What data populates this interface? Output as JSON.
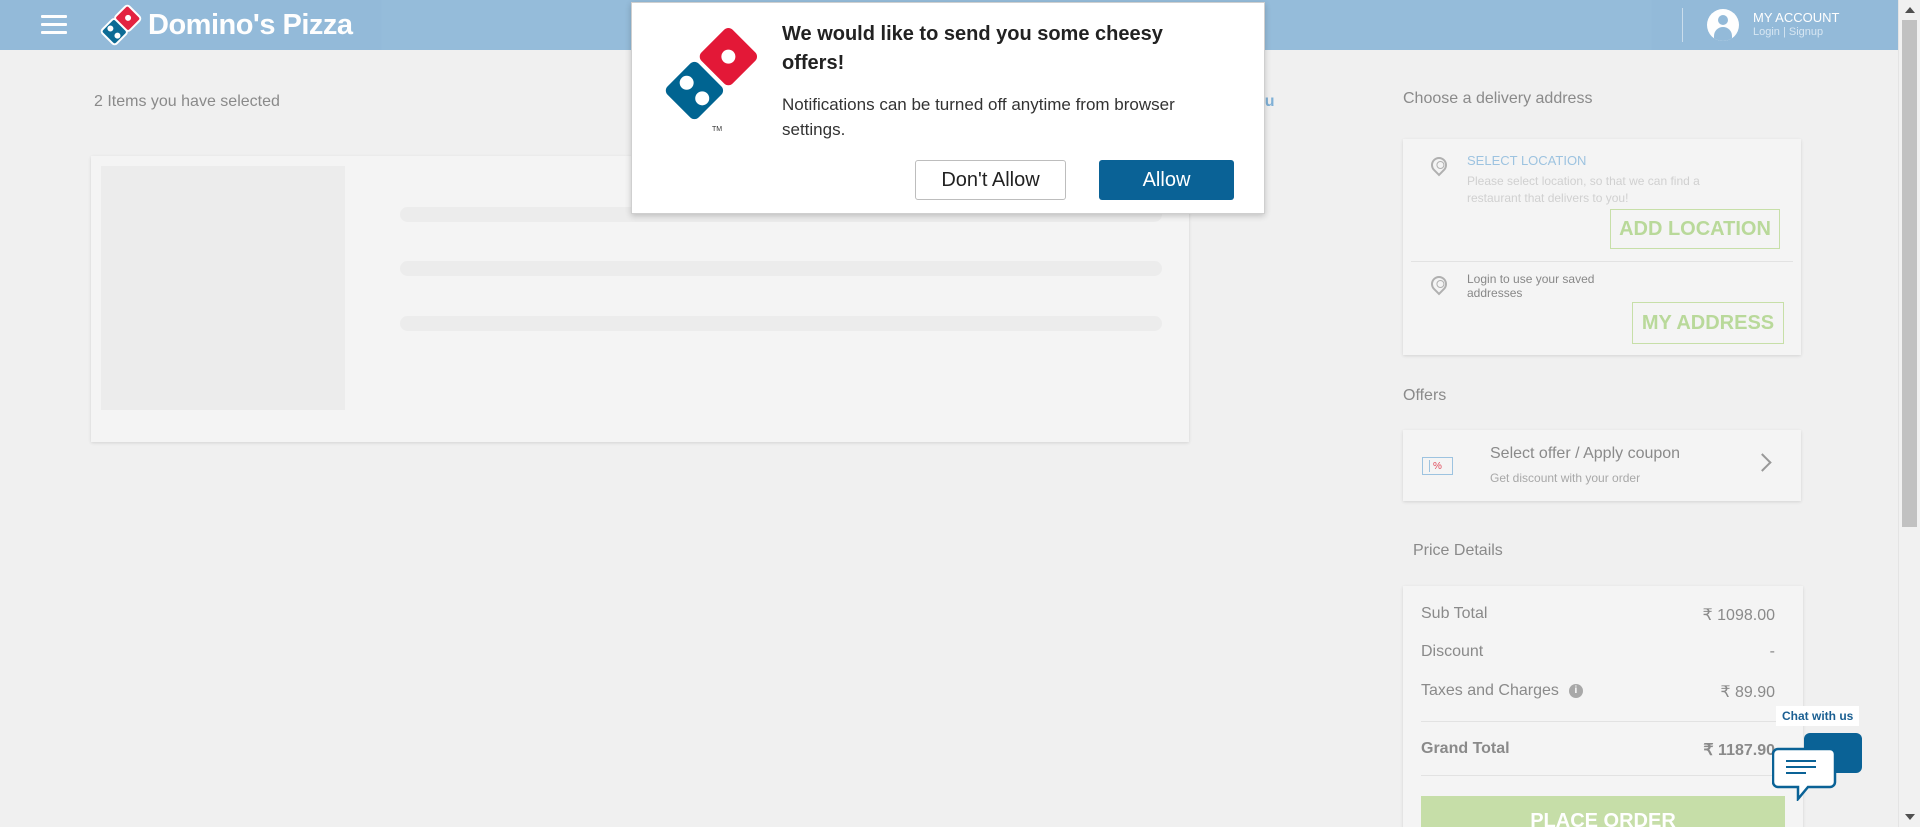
{
  "header": {
    "logo_text": "Domino's Pizza",
    "account_title": "MY ACCOUNT",
    "account_sub": "Login | Signup"
  },
  "cart": {
    "items_title": "2 Items you have selected",
    "menu_link_partial": "nu"
  },
  "delivery": {
    "section_title": "Choose a delivery address",
    "select_location_title": "SELECT LOCATION",
    "select_location_desc": "Please select location, so that we can find a restaurant that delivers to you!",
    "add_location_label": "ADD LOCATION",
    "saved_desc": "Login to use your saved addresses",
    "my_address_label": "MY ADDRESS"
  },
  "offers": {
    "section_title": "Offers",
    "title": "Select offer / Apply coupon",
    "subtitle": "Get discount with your order",
    "coupon_glyph": "%"
  },
  "price": {
    "section_title": "Price Details",
    "sub_total_label": "Sub Total",
    "sub_total_value": "₹ 1098.00",
    "discount_label": "Discount",
    "discount_value": "-",
    "taxes_label": "Taxes and Charges",
    "taxes_value": "₹ 89.90",
    "grand_label": "Grand Total",
    "grand_value": "₹ 1187.90",
    "place_order_label": "PLACE ORDER",
    "info_glyph": "i"
  },
  "chat": {
    "label": "Chat with us"
  },
  "notification": {
    "title": "We would like to send you some cheesy offers!",
    "message": "Notifications can be turned off anytime from browser settings.",
    "deny_label": "Don't Allow",
    "allow_label": "Allow",
    "tm": "TM"
  },
  "colors": {
    "header_bg": "#8fb8d8",
    "allow_button": "#0a6296",
    "place_order": "#c6dea8",
    "domino_red": "#e31837",
    "domino_blue": "#006491"
  }
}
